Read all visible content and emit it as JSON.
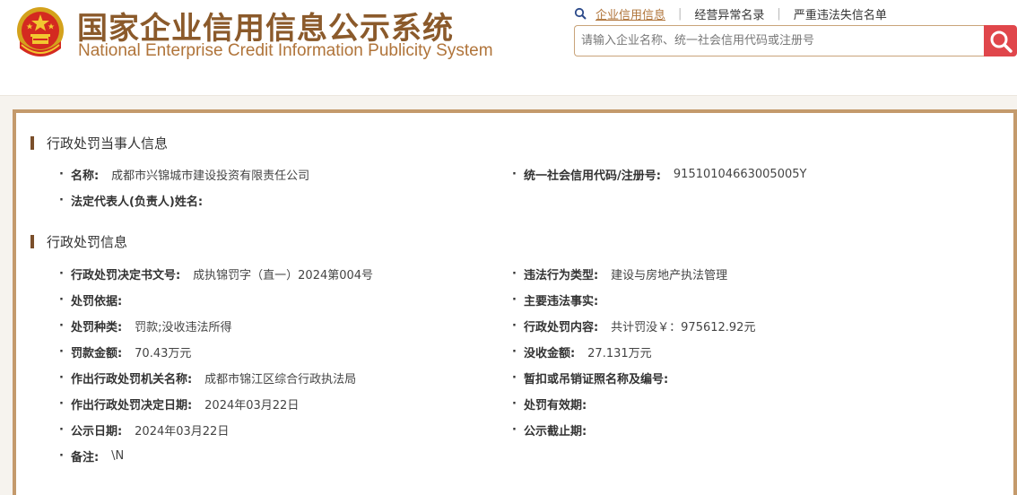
{
  "header": {
    "title_cn": "国家企业信用信息公示系统",
    "title_en": "National Enterprise Credit Information Publicity System",
    "links": [
      "企业信用信息",
      "经营异常名录",
      "严重违法失信名单"
    ],
    "search_placeholder": "请输入企业名称、统一社会信用代码或注册号",
    "search_icon": "search-icon",
    "emblem_icon": "national-emblem-icon"
  },
  "colors": {
    "title": "#8b5a2b",
    "accent": "#b0743a",
    "search_button": "#e0464b",
    "panel_border": "#c49a6c",
    "section_bar": "#7b4f2b"
  },
  "party_section": {
    "title": "行政处罚当事人信息",
    "fields": [
      {
        "label": "名称:",
        "value": "成都市兴锦城市建设投资有限责任公司"
      },
      {
        "label": "统一社会信用代码/注册号:",
        "value": "91510104663005005Y"
      },
      {
        "label": "法定代表人(负责人)姓名:",
        "value": ""
      }
    ]
  },
  "penalty_section": {
    "title": "行政处罚信息",
    "fields": [
      {
        "label": "行政处罚决定书文号:",
        "value": "成执锦罚字（直一）2024第004号"
      },
      {
        "label": "违法行为类型:",
        "value": "建设与房地产执法管理"
      },
      {
        "label": "处罚依据:",
        "value": ""
      },
      {
        "label": "主要违法事实:",
        "value": ""
      },
      {
        "label": "处罚种类:",
        "value": "罚款;没收违法所得"
      },
      {
        "label": "行政处罚内容:",
        "value": "共计罚没￥：975612.92元"
      },
      {
        "label": "罚款金额:",
        "value": "70.43万元"
      },
      {
        "label": "没收金额:",
        "value": "27.131万元"
      },
      {
        "label": "作出行政处罚机关名称:",
        "value": "成都市锦江区综合行政执法局"
      },
      {
        "label": "暂扣或吊销证照名称及编号:",
        "value": ""
      },
      {
        "label": "作出行政处罚决定日期:",
        "value": "2024年03月22日"
      },
      {
        "label": "处罚有效期:",
        "value": ""
      },
      {
        "label": "公示日期:",
        "value": "2024年03月22日"
      },
      {
        "label": "公示截止期:",
        "value": ""
      },
      {
        "label": "备注:",
        "value": "\\N"
      }
    ]
  }
}
